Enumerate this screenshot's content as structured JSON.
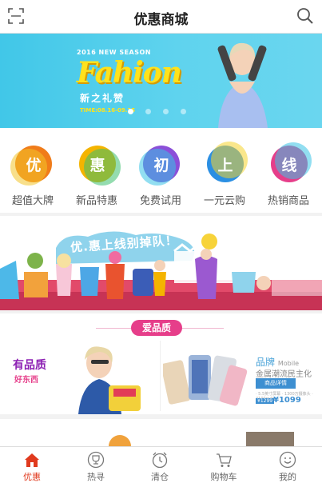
{
  "header": {
    "title": "优惠商城"
  },
  "banner": {
    "season": "2016 NEW SEASON",
    "headline": "Fahion",
    "subtitle": "新之礼赞",
    "time": "TIME:08.16-09.15",
    "slide_count": 4,
    "active_slide": 1
  },
  "categories": [
    {
      "char": "优",
      "label": "超值大牌",
      "color": "#f07c1a"
    },
    {
      "char": "惠",
      "label": "新品特惠",
      "color": "#f4b400"
    },
    {
      "char": "初",
      "label": "免费试用",
      "color": "#8b4fd8"
    },
    {
      "char": "上",
      "label": "一元云购",
      "color": "#2b8fe3"
    },
    {
      "char": "线",
      "label": "热销商品",
      "color": "#e63e8a"
    }
  ],
  "promo": {
    "slogan": "优.惠上线别掉队！"
  },
  "quality": {
    "tag": "爱品质",
    "title": "有品质",
    "subtitle": "好东西",
    "brand_name": "品牌",
    "brand_en": "Mobile",
    "brand_line": "金属潮流民主化",
    "detail_button": "商品详情",
    "small_note": "· 5.5英寸屏幕  · 1300万摄像头  · 4100mAh",
    "price_old": "¥1299",
    "price": "¥1099"
  },
  "tabbar": {
    "items": [
      {
        "label": "优惠",
        "icon": "home-icon",
        "active": true
      },
      {
        "label": "热寻",
        "icon": "trophy-icon",
        "active": false
      },
      {
        "label": "清仓",
        "icon": "clock-icon",
        "active": false
      },
      {
        "label": "购物车",
        "icon": "cart-icon",
        "active": false
      },
      {
        "label": "我的",
        "icon": "smile-icon",
        "active": false
      }
    ]
  },
  "colors": {
    "accent": "#e03a1e",
    "banner_bg": "#41c7e8",
    "quality_pink": "#e63e8a"
  }
}
